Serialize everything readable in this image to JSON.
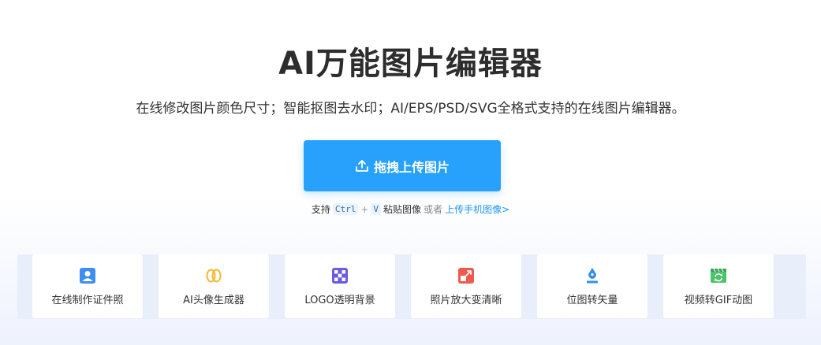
{
  "hero": {
    "title": "AI万能图片编辑器",
    "subtitle": "在线修改图片颜色尺寸；智能抠图去水印；AI/EPS/PSD/SVG全格式支持的在线图片编辑器。"
  },
  "upload": {
    "button_label": "拖拽上传图片",
    "icon": "upload-icon",
    "accent_color": "#27a1fb"
  },
  "hint": {
    "prefix": "支持",
    "key_ctrl": "Ctrl",
    "plus": "+",
    "key_v": "V",
    "paste_text": "粘贴图像",
    "or_text": "或者",
    "mobile_link": "上传手机图像>"
  },
  "tools": [
    {
      "label": "在线制作证件照",
      "icon": "id-photo-icon",
      "color": "#3d8ef0"
    },
    {
      "label": "AI头像生成器",
      "icon": "avatar-generator-icon",
      "color": "#f5b82e"
    },
    {
      "label": "LOGO透明背景",
      "icon": "transparent-background-icon",
      "color": "#6a5ae6"
    },
    {
      "label": "照片放大变清晰",
      "icon": "enlarge-photo-icon",
      "color": "#f05a4e"
    },
    {
      "label": "位图转矢量",
      "icon": "vectorize-pen-icon",
      "color": "#2f8ff0"
    },
    {
      "label": "视频转GIF动图",
      "icon": "video-to-gif-icon",
      "color": "#4cc46a"
    }
  ]
}
